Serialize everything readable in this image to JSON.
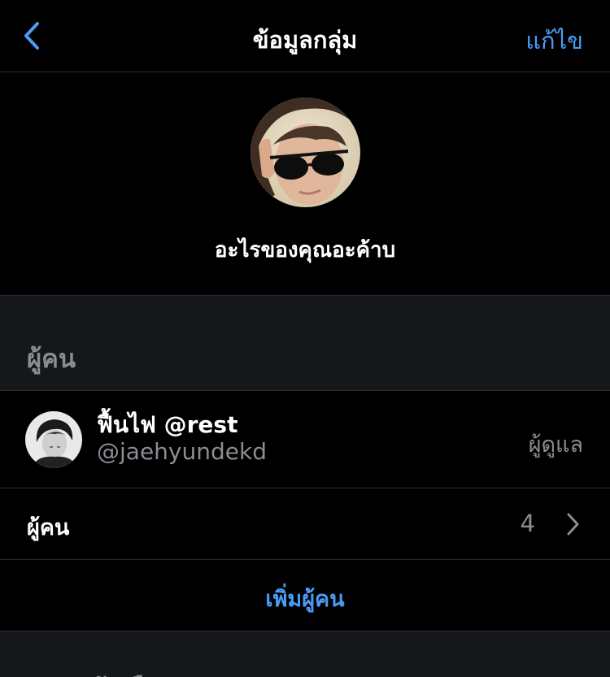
{
  "navbar": {
    "back_icon": "chevron-left-icon",
    "title": "ข้อมูลกลุ่ม",
    "edit_label": "แก้ไข",
    "accent_color": "#4a9cf6"
  },
  "group": {
    "name": "อะไรของคุณอะค้าบ"
  },
  "people_section": {
    "label": "ผู้คน"
  },
  "member": {
    "name": "ฟื้นไฟ @rest",
    "handle": "@jaehyundekd",
    "role": "ผู้ดูแล"
  },
  "people_row": {
    "label": "ผู้คน",
    "count": "4",
    "chevron_icon": "chevron-right-icon"
  },
  "add_people": {
    "label": "เพิ่มผู้คน"
  },
  "next_section": {
    "label": "ตัวเลือก"
  }
}
